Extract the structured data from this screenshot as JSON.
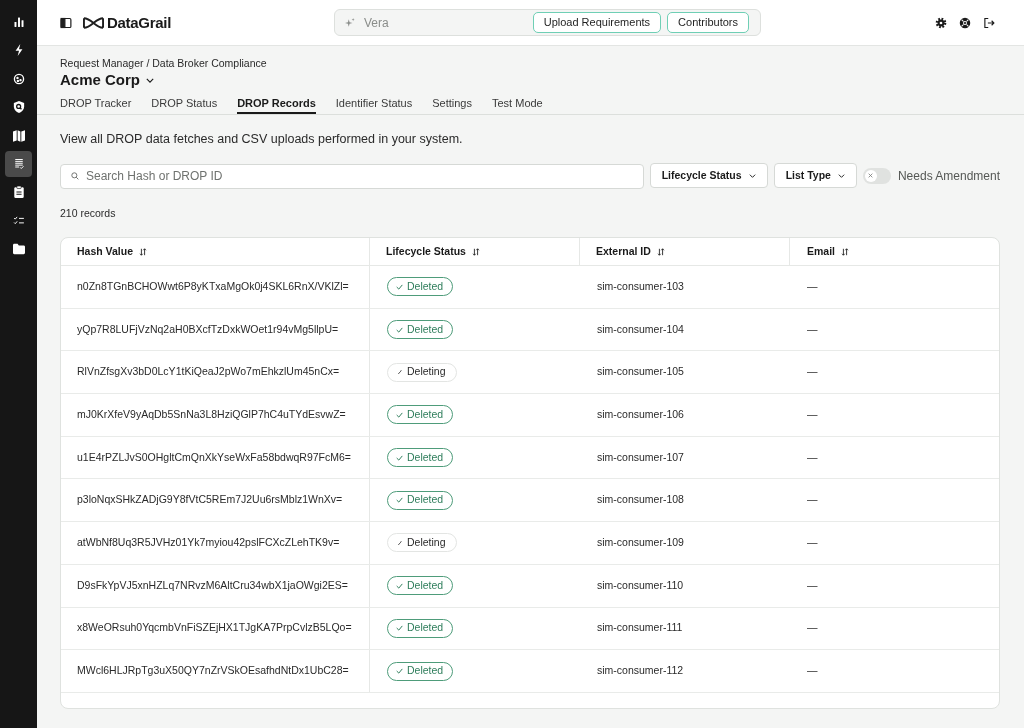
{
  "sidebar": {
    "items": [
      {
        "selected": false
      },
      {
        "selected": false
      },
      {
        "selected": false
      },
      {
        "selected": false
      },
      {
        "selected": false
      },
      {
        "selected": true
      },
      {
        "selected": false
      },
      {
        "selected": false
      },
      {
        "selected": false
      }
    ]
  },
  "top_bar": {
    "logo": "DataGrail",
    "assistant": {
      "placeholder": "Vera"
    },
    "buttons": [
      "Upload Requirements",
      "Contributors"
    ]
  },
  "breadcrumb": "Request Manager / Data Broker Compliance",
  "account": "Acme Corp",
  "tabs": [
    {
      "label": "DROP Tracker",
      "selected": false
    },
    {
      "label": "DROP Status",
      "selected": false
    },
    {
      "label": "DROP Records",
      "selected": true
    },
    {
      "label": "Identifier Status",
      "selected": false
    },
    {
      "label": "Settings",
      "selected": false
    },
    {
      "label": "Test Mode",
      "selected": false
    }
  ],
  "description": "View all DROP data fetches and CSV uploads performed in your system.",
  "search": {
    "placeholder": "Search Hash or DROP ID"
  },
  "filters": [
    "Lifecycle Status",
    "List Type"
  ],
  "needs_amendment": {
    "label": "Needs Amendment",
    "on": false
  },
  "record_count": "210 records",
  "table": {
    "columns": [
      "Hash Value",
      "Lifecycle Status",
      "External ID",
      "Email"
    ],
    "rows": [
      {
        "hash_value": "n0Zn8TGnBCHOWwt6P8yKTxaMgOk0j4SKL6RnX/VKlZl=",
        "lifecycle_status": {
          "label": "Deleted",
          "kind": "deleted"
        },
        "external_id": "sim-consumer-103",
        "email": "—"
      },
      {
        "hash_value": "yQp7R8LUFjVzNq2aH0BXcfTzDxkWOet1r94vMg5llpU=",
        "lifecycle_status": {
          "label": "Deleted",
          "kind": "deleted"
        },
        "external_id": "sim-consumer-104",
        "email": "—"
      },
      {
        "hash_value": "RlVnZfsgXv3bD0LcY1tKiQeaJ2pWo7mEhkzlUm45nCx=",
        "lifecycle_status": {
          "label": "Deleting",
          "kind": "deleting"
        },
        "external_id": "sim-consumer-105",
        "email": "—"
      },
      {
        "hash_value": "mJ0KrXfeV9yAqDb5SnNa3L8HziQGlP7hC4uTYdEsvwZ=",
        "lifecycle_status": {
          "label": "Deleted",
          "kind": "deleted"
        },
        "external_id": "sim-consumer-106",
        "email": "—"
      },
      {
        "hash_value": "u1E4rPZLJvS0OHgltCmQnXkYseWxFa58bdwqR97FcM6=",
        "lifecycle_status": {
          "label": "Deleted",
          "kind": "deleted"
        },
        "external_id": "sim-consumer-107",
        "email": "—"
      },
      {
        "hash_value": "p3loNqxSHkZADjG9Y8fVtC5REm7J2Uu6rsMblz1WnXv=",
        "lifecycle_status": {
          "label": "Deleted",
          "kind": "deleted"
        },
        "external_id": "sim-consumer-108",
        "email": "—"
      },
      {
        "hash_value": "atWbNf8Uq3R5JVHz01Yk7myiou42pslFCXcZLehTK9v=",
        "lifecycle_status": {
          "label": "Deleting",
          "kind": "deleting"
        },
        "external_id": "sim-consumer-109",
        "email": "—"
      },
      {
        "hash_value": "D9sFkYpVJ5xnHZLq7NRvzM6AltCru34wbX1jaOWgi2ES=",
        "lifecycle_status": {
          "label": "Deleted",
          "kind": "deleted"
        },
        "external_id": "sim-consumer-110",
        "email": "—"
      },
      {
        "hash_value": "x8WeORsuh0YqcmbVnFiSZEjHX1TJgKA7PrpCvlzB5LQo=",
        "lifecycle_status": {
          "label": "Deleted",
          "kind": "deleted"
        },
        "external_id": "sim-consumer-111",
        "email": "—"
      },
      {
        "hash_value": "MWcl6HLJRpTg3uX50QY7nZrVSkOEsafhdNtDx1UbC28=",
        "lifecycle_status": {
          "label": "Deleted",
          "kind": "deleted"
        },
        "external_id": "sim-consumer-112",
        "email": "—"
      }
    ]
  }
}
